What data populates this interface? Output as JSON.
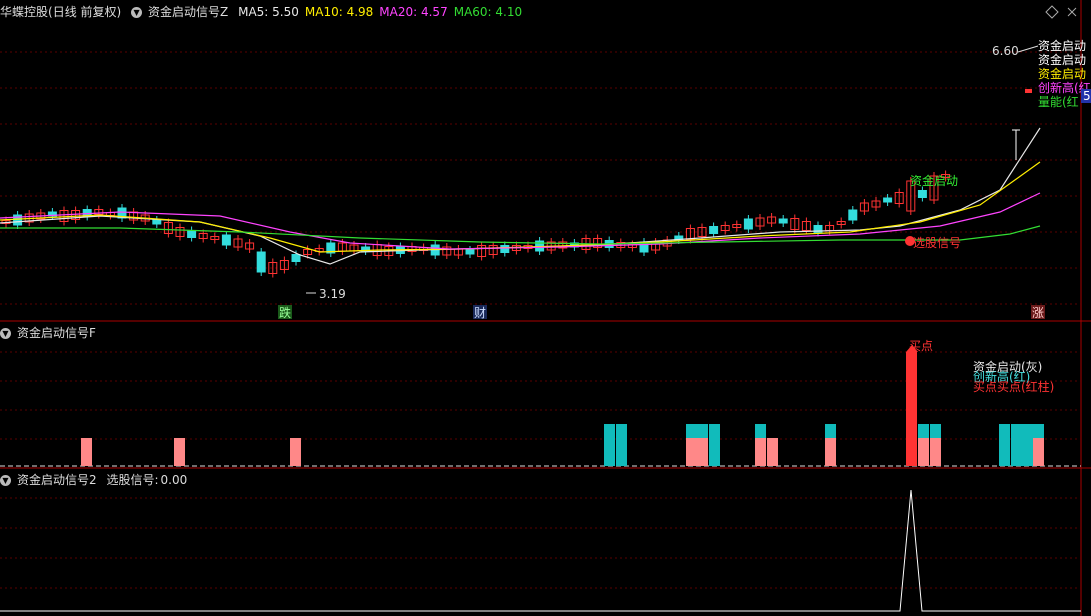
{
  "main_panel": {
    "stock_name": "华蝶控股",
    "period": "(日线 前复权)",
    "indicator_name": "资金启动信号Z",
    "ma_labels": [
      {
        "label": "MA5:",
        "value": "5.50",
        "color": "#e8e8e8"
      },
      {
        "label": "MA10:",
        "value": "4.98",
        "color": "#ffee00"
      },
      {
        "label": "MA20:",
        "value": "4.57",
        "color": "#ff44ff"
      },
      {
        "label": "MA60:",
        "value": "4.10",
        "color": "#33dd33"
      }
    ],
    "high_label": "6.60",
    "low_label": "3.19",
    "signal_text": "资金启动",
    "pick_text": "选股信号",
    "legend": [
      {
        "text": "资金启动",
        "color": "#ffffff"
      },
      {
        "text": "资金启动",
        "color": "#ffffff"
      },
      {
        "text": "资金启动",
        "color": "#ffee00"
      },
      {
        "text": "创新高(红",
        "color": "#ff44ff"
      },
      {
        "text": "量能(红",
        "color": "#33dd33"
      }
    ],
    "right_badge": "5",
    "markers": [
      {
        "text": "跌",
        "bg": "#1a5a1a",
        "color": "#9f9"
      },
      {
        "text": "财",
        "bg": "#1a2a5a",
        "color": "#cdf"
      },
      {
        "text": "涨",
        "bg": "#6a1a1a",
        "color": "#fcc"
      }
    ]
  },
  "panel2": {
    "indicator_name": "资金启动信号F",
    "legend": [
      {
        "text": "资金启动(灰)",
        "color": "#e8e8e8"
      },
      {
        "text": "创新高(红)",
        "color": "#44dddd"
      },
      {
        "text": "买点买点(红柱)",
        "color": "#ff3333"
      }
    ],
    "peak_label": "买点"
  },
  "panel3": {
    "indicator_name": "资金启动信号2",
    "value_label": "选股信号:",
    "value": "0.00"
  },
  "colors": {
    "up": "#ff3333",
    "down": "#33dddd",
    "grid": "#7a0000",
    "pink": "#ff8888",
    "teal": "#11bbbb"
  }
}
